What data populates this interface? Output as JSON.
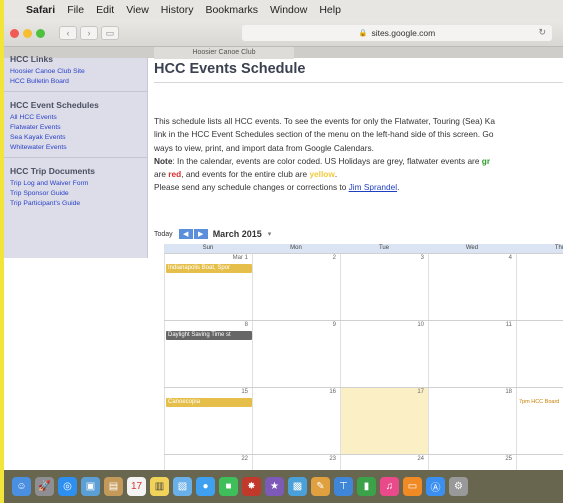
{
  "menubar": {
    "items": [
      "Safari",
      "File",
      "Edit",
      "View",
      "History",
      "Bookmarks",
      "Window",
      "Help"
    ]
  },
  "browser": {
    "url": "sites.google.com",
    "tab_title": "Hoosier Canoe Club"
  },
  "sidebar": {
    "top_section_title": "HCC Links",
    "top_links": [
      "Hoosier Canoe Club Site",
      "HCC Bulletin Board"
    ],
    "schedules_title": "HCC Event Schedules",
    "schedule_links": [
      "All HCC Events",
      "Flatwater Events",
      "Sea Kayak Events",
      "Whitewater Events"
    ],
    "trip_docs_title": "HCC Trip Documents",
    "trip_links": [
      "Trip Log and Waiver Form",
      "Trip Sponsor Guide",
      "Trip Participant's Guide"
    ]
  },
  "main": {
    "title": "HCC Events Schedule",
    "desc_line1": "This schedule lists all HCC events. To see the events for only the Flatwater, Touring (Sea) Ka",
    "desc_line2": "link in the HCC Event Schedules section of the menu on the left-hand side of this screen.  Go",
    "desc_line3": "ways to view, print, and import data from Google Calendars.",
    "note_label": "Note",
    "note_text": ": In the calendar, events are color coded.  US Holidays are grey, flatwater events are ",
    "note_green": "gr",
    "line5_a": "are ",
    "line5_red": "red",
    "line5_b": ", and events for the entire club are ",
    "line5_yellow": "yellow",
    "line5_c": ".",
    "corrections_text": "Please send any schedule changes or corrections to ",
    "corrections_link": "Jim Sprandel",
    "corrections_end": "."
  },
  "calendar": {
    "today_label": "Today",
    "prev": "◀",
    "next": "▶",
    "month": "March 2015",
    "dropdown": "▾",
    "day_headers": [
      "Sun",
      "Mon",
      "Tue",
      "Wed",
      "Thu"
    ],
    "weeks": [
      {
        "dates": [
          "Mar 1",
          "2",
          "3",
          "4",
          ""
        ]
      },
      {
        "dates": [
          "8",
          "9",
          "10",
          "11",
          ""
        ]
      },
      {
        "dates": [
          "15",
          "16",
          "17",
          "18",
          ""
        ]
      },
      {
        "dates": [
          "22",
          "23",
          "24",
          "25",
          ""
        ]
      }
    ],
    "events": {
      "e1": "Indianapolis Boat, Spor",
      "e2": "Daylight Saving Time st",
      "e3": "Canoecopia",
      "e4": "7pm HCC Board"
    }
  },
  "colors": {
    "holiday": "#666666",
    "club_event": "#e5bf4a",
    "today_highlight": "#fbefc5",
    "link": "#2a41c8"
  },
  "dock_icons": [
    "finder-icon",
    "launchpad-icon",
    "safari-icon",
    "photos-icon",
    "notes-icon",
    "calendar-icon",
    "stickies-icon",
    "preview-icon",
    "messages-icon",
    "facetime-icon",
    "photo-booth-icon",
    "imovie-icon",
    "app-store-icon",
    "pages-icon",
    "keynote-icon",
    "numbers-icon",
    "itunes-icon",
    "ibooks-icon",
    "app-store-2-icon",
    "system-prefs-icon"
  ]
}
